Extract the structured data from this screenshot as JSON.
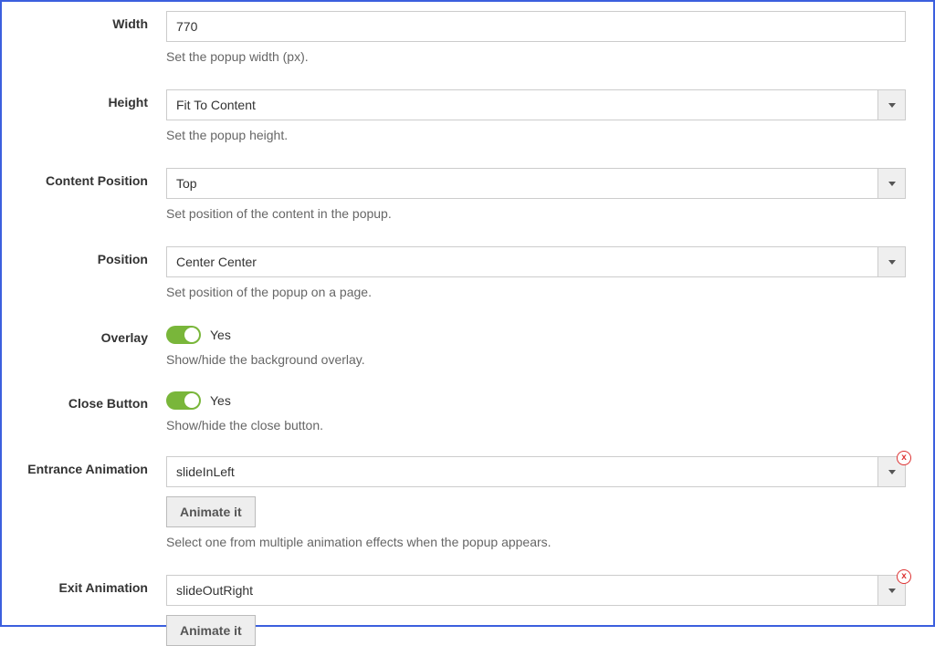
{
  "width": {
    "label": "Width",
    "value": "770",
    "help": "Set the popup width (px)."
  },
  "height": {
    "label": "Height",
    "value": "Fit To Content",
    "help": "Set the popup height."
  },
  "contentPosition": {
    "label": "Content Position",
    "value": "Top",
    "help": "Set position of the content in the popup."
  },
  "position": {
    "label": "Position",
    "value": "Center Center",
    "help": "Set position of the popup on a page."
  },
  "overlay": {
    "label": "Overlay",
    "value": "Yes",
    "help": "Show/hide the background overlay."
  },
  "closeButton": {
    "label": "Close Button",
    "value": "Yes",
    "help": "Show/hide the close button."
  },
  "entranceAnimation": {
    "label": "Entrance Animation",
    "value": "slideInLeft",
    "button": "Animate it",
    "help": "Select one from multiple animation effects when the popup appears.",
    "clear": "x"
  },
  "exitAnimation": {
    "label": "Exit Animation",
    "value": "slideOutRight",
    "button": "Animate it",
    "clear": "x"
  }
}
